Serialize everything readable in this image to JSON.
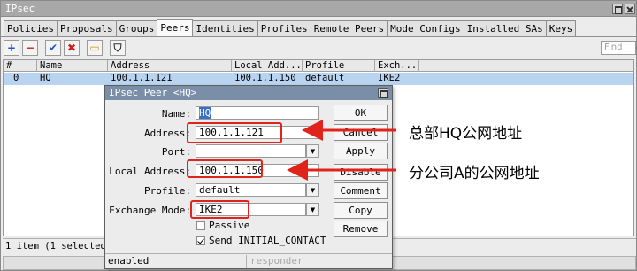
{
  "window": {
    "title": "IPsec"
  },
  "tabs": [
    "Policies",
    "Proposals",
    "Groups",
    "Peers",
    "Identities",
    "Profiles",
    "Remote Peers",
    "Mode Configs",
    "Installed SAs",
    "Keys"
  ],
  "toolbar": {
    "add_icon": "+",
    "remove_icon": "−",
    "enable_icon": "✔",
    "disable_icon": "✖",
    "comment_icon": "▭",
    "filter_icon": "⛉",
    "find_placeholder": "Find"
  },
  "table": {
    "columns": [
      "#",
      "Name",
      "Address",
      "Local Add...",
      "Profile",
      "Exch..."
    ],
    "rows": [
      {
        "index": "0",
        "name": "HQ",
        "address": "100.1.1.121",
        "local_address": "100.1.1.150",
        "profile": "default",
        "exchange": "IKE2"
      }
    ]
  },
  "status": {
    "items": "1 item (1 selected)"
  },
  "dialog": {
    "title": "IPsec Peer <HQ>",
    "fields": {
      "name_label": "Name:",
      "name_value": "HQ",
      "address_label": "Address:",
      "address_value": "100.1.1.121",
      "port_label": "Port:",
      "port_value": "",
      "local_address_label": "Local Address:",
      "local_address_value": "100.1.1.150",
      "profile_label": "Profile:",
      "profile_value": "default",
      "exchange_mode_label": "Exchange Mode:",
      "exchange_mode_value": "IKE2",
      "passive_label": "Passive",
      "passive_checked": false,
      "send_initial_label": "Send INITIAL_CONTACT",
      "send_initial_checked": true
    },
    "buttons": [
      "OK",
      "Cancel",
      "Apply",
      "Disable",
      "Comment",
      "Copy",
      "Remove"
    ],
    "status_left": "enabled",
    "status_right": "responder"
  },
  "annotations": {
    "address_note": "总部HQ公网地址",
    "local_address_note": "分公司A的公网地址",
    "color": "#e0231b"
  }
}
